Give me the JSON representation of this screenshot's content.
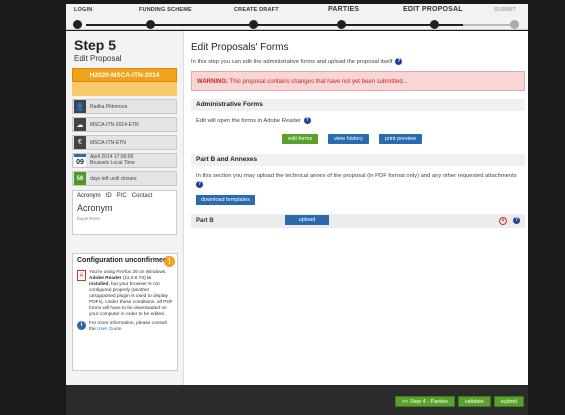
{
  "stepper": {
    "steps": [
      "LOGIN",
      "FUNDING SCHEME",
      "CREATE DRAFT",
      "PARTIES",
      "EDIT PROPOSAL",
      "SUBMIT"
    ]
  },
  "sidebar": {
    "title": "Step 5",
    "subtitle": "Edit Proposal",
    "proposal_id": "H2020-MSCA-ITN-2014",
    "user": "Radka Pittrerova",
    "call": "MSCA-ITN-2014-ETN",
    "scheme": "MSCA-ITN-ETN",
    "deadline_day": "09",
    "deadline_line1": "April 2014  17:00:00",
    "deadline_line2": "Brussels Local Time",
    "days_left": "56",
    "days_left_label": "days left until closure",
    "tabs": [
      "Acronym",
      "ID",
      "PIC",
      "Contact"
    ],
    "acronym_value": "Acronym",
    "acronym_sub": "Experiment"
  },
  "config": {
    "title": "Configuration unconfirmed",
    "warn_glyph": "!",
    "pdf_text_1": "You're using Firefox 26 on Windows. ",
    "pdf_bold": "Adobe Reader",
    "pdf_text_2": "(11.0.6.70) ",
    "pdf_bold_2": "is installed",
    "pdf_text_3": ", but your browser is not configured properly (another unsupported plugin is used to display PDFs). Under these conditions, all PDF forms will have to be downloaded on your computer in order to be edited.",
    "more_text": "For more information, please consult the ",
    "more_link": "User Guide",
    "more_end": "."
  },
  "main": {
    "title": "Edit Proposals' Forms",
    "intro": "In this step you can edit the administrative forms and upload the proposal itself",
    "warning_label": "WARNING:",
    "warning_text": " This proposal contains changes that have not yet been submitted...",
    "admin_title": "Administrative Forms",
    "admin_text": "Edit will open the forms in Adobe Reader",
    "btn_edit": "edit forms",
    "btn_history": "view history",
    "btn_print": "print preview",
    "partb_title": "Part B and Annexes",
    "partb_text": "In this section you may upload the technical annex of the proposal (in PDF format only) and any other requested attachments",
    "btn_download": "download templates",
    "partb_row_label": "Part B",
    "btn_upload": "upload"
  },
  "footer": {
    "btn_prev": "<< Step 4 - Parties",
    "btn_validate": "validate",
    "btn_submit": "submit"
  },
  "icons": {
    "qmark": "?",
    "delete": "×",
    "user": "👤",
    "cloud": "☁",
    "euro": "€",
    "pdf": "A",
    "info": "i"
  },
  "colors": {
    "accent_orange": "#f1a21c",
    "accent_blue": "#2a6bb0",
    "accent_green": "#5aa02c",
    "warning_bg": "#f9d6d6",
    "warning_text": "#cc2222"
  }
}
